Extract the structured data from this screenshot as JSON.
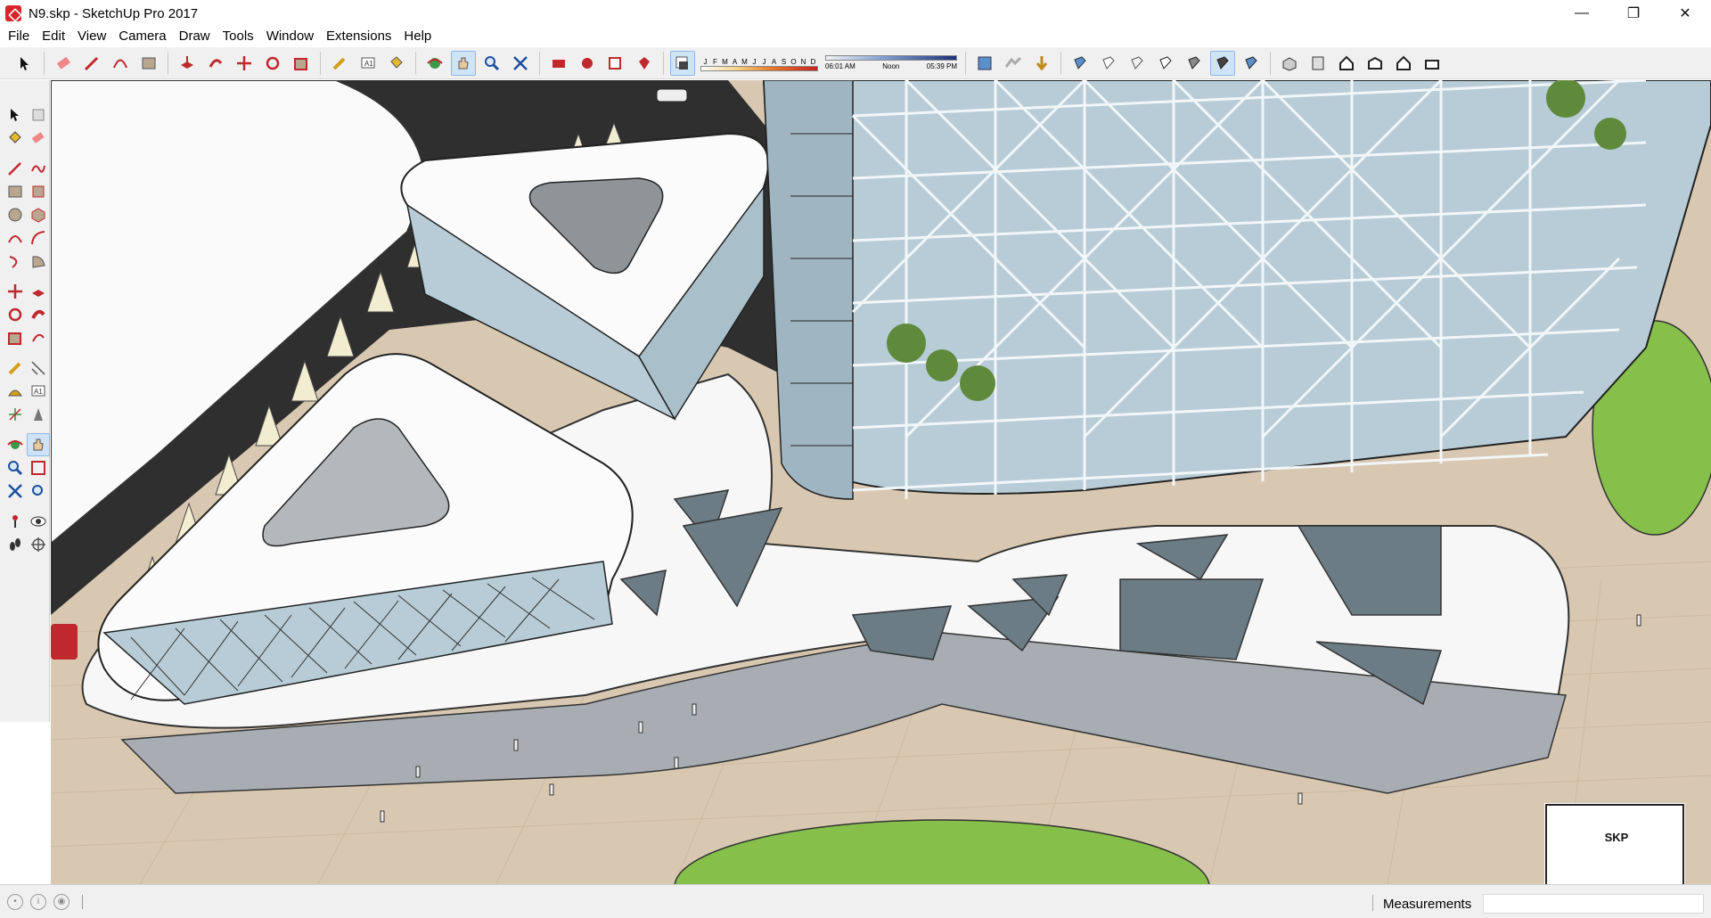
{
  "window": {
    "title": "N9.skp - SketchUp Pro 2017",
    "minimize": "—",
    "maximize": "❐",
    "close": "✕"
  },
  "menu": [
    "File",
    "Edit",
    "View",
    "Camera",
    "Draw",
    "Tools",
    "Window",
    "Extensions",
    "Help"
  ],
  "shadows": {
    "months": [
      "J",
      "F",
      "M",
      "A",
      "M",
      "J",
      "J",
      "A",
      "S",
      "O",
      "N",
      "D"
    ],
    "time_start": "06:01 AM",
    "time_mid": "Noon",
    "time_end": "05:39 PM"
  },
  "status": {
    "measurements_label": "Measurements",
    "measurements_value": ""
  },
  "thumbnail": {
    "logo_text": "SKP"
  },
  "colors": {
    "accent": "#d8262b",
    "glass": "#b7ccd6",
    "ground": "#d6c4ad",
    "road": "#2d2d2d",
    "lawn": "#86c04b"
  }
}
